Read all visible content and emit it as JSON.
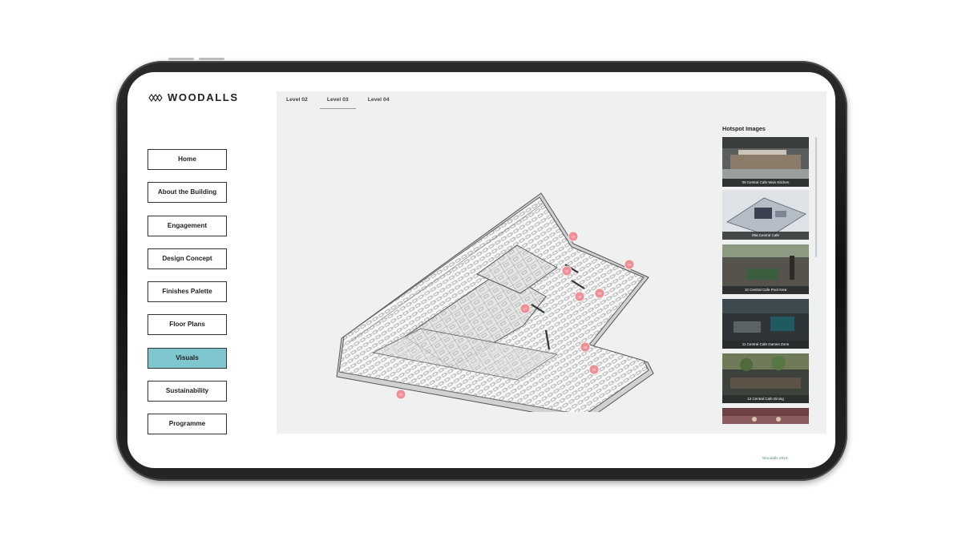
{
  "brand": {
    "name": "WOODALLS",
    "logo_icon": "interlocking-diamonds-icon"
  },
  "nav": {
    "items": [
      {
        "label": "Home",
        "active": false
      },
      {
        "label": "About the Building",
        "active": false
      },
      {
        "label": "Engagement",
        "active": false
      },
      {
        "label": "Design Concept",
        "active": false
      },
      {
        "label": "Finishes Palette",
        "active": false
      },
      {
        "label": "Floor Plans",
        "active": false
      },
      {
        "label": "Visuals",
        "active": true
      },
      {
        "label": "Sustainability",
        "active": false
      },
      {
        "label": "Programme",
        "active": false
      }
    ]
  },
  "tabs": [
    {
      "label": "Level 02",
      "active": false
    },
    {
      "label": "Level 03",
      "active": true
    },
    {
      "label": "Level 04",
      "active": false
    }
  ],
  "hotspots": {
    "title": "Hotspot Images",
    "items": [
      {
        "caption": "09 Central Cafe Main Kitchen"
      },
      {
        "caption": "09a Central Cafe"
      },
      {
        "caption": "10 Central Cafe Pool Area"
      },
      {
        "caption": "11 Central Cafe Games Zone"
      },
      {
        "caption": "12 Central Cafe Dining"
      },
      {
        "caption": ""
      }
    ]
  },
  "plan_markers": [
    "13",
    "14",
    "15",
    "16",
    "17",
    "18",
    "19",
    "20",
    "21"
  ],
  "footer": {
    "text": "Woodalls 2024"
  },
  "colors": {
    "accent": "#7fc6cf",
    "marker": "#ef8f96",
    "panel": "#eef1f0",
    "footer_text": "#5a8d80"
  }
}
